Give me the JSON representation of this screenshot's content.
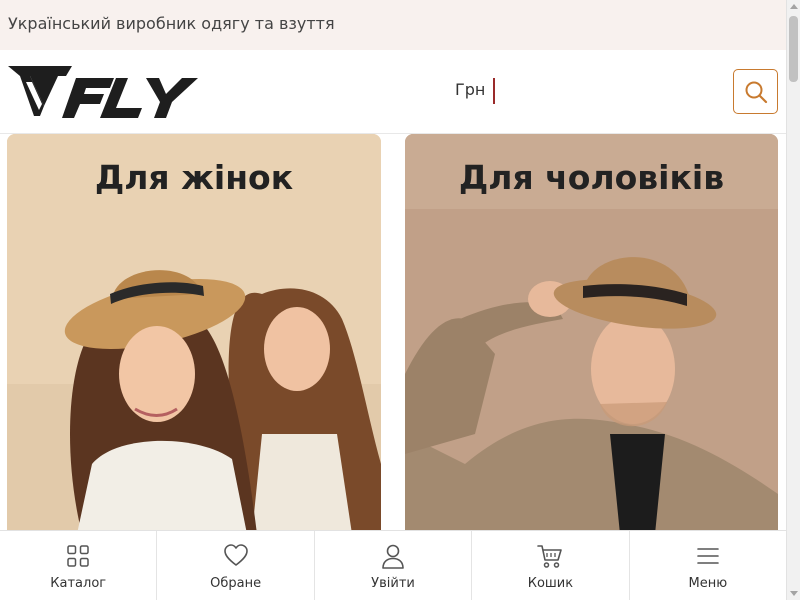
{
  "topbar": {
    "tagline": "Український виробник одягу та взуття"
  },
  "header": {
    "logo_text": "FLY",
    "currency": "Грн",
    "accent_color": "#c87a2f"
  },
  "categories": [
    {
      "title": "Для жінок",
      "bg_color": "#e9d2b3"
    },
    {
      "title": "Для чоловіків",
      "bg_color": "#c9ab93"
    }
  ],
  "bottom_nav": [
    {
      "label": "Каталог",
      "icon": "grid-icon"
    },
    {
      "label": "Обране",
      "icon": "heart-icon"
    },
    {
      "label": "Увійти",
      "icon": "user-icon"
    },
    {
      "label": "Кошик",
      "icon": "cart-icon"
    },
    {
      "label": "Меню",
      "icon": "menu-icon"
    }
  ]
}
